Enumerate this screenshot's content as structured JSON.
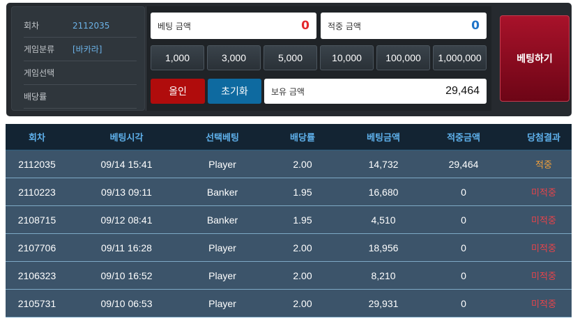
{
  "info": {
    "rows": [
      {
        "label": "회차",
        "value": "2112035"
      },
      {
        "label": "게임분류",
        "value": "[바카라]"
      },
      {
        "label": "게임선택",
        "value": ""
      },
      {
        "label": "배당률",
        "value": ""
      }
    ]
  },
  "bet_panel": {
    "bet_amount_label": "베팅 금액",
    "bet_amount_value": "0",
    "win_amount_label": "적중 금액",
    "win_amount_value": "0",
    "chips": [
      "1,000",
      "3,000",
      "5,000",
      "10,000",
      "100,000",
      "1,000,000"
    ],
    "allin_label": "올인",
    "reset_label": "초기화",
    "balance_label": "보유 금액",
    "balance_value": "29,464",
    "bet_button_label": "베팅하기"
  },
  "colors": {
    "bet_value": "#e3262b",
    "win_value": "#1e73c8",
    "allin_bg": "#b00c0c",
    "reset_bg": "#0e6aa0",
    "status_win": "#f2a03a",
    "status_miss": "#e8434a"
  },
  "table": {
    "headers": [
      "회차",
      "베팅시각",
      "선택베팅",
      "배당률",
      "베팅금액",
      "적중금액",
      "당첨결과"
    ],
    "rows": [
      {
        "round": "2112035",
        "time": "09/14 15:41",
        "pick": "Player",
        "odds": "2.00",
        "bet": "14,732",
        "win": "29,464",
        "result": "적중",
        "status": "win"
      },
      {
        "round": "2110223",
        "time": "09/13 09:11",
        "pick": "Banker",
        "odds": "1.95",
        "bet": "16,680",
        "win": "0",
        "result": "미적중",
        "status": "miss"
      },
      {
        "round": "2108715",
        "time": "09/12 08:41",
        "pick": "Banker",
        "odds": "1.95",
        "bet": "4,510",
        "win": "0",
        "result": "미적중",
        "status": "miss"
      },
      {
        "round": "2107706",
        "time": "09/11 16:28",
        "pick": "Player",
        "odds": "2.00",
        "bet": "18,956",
        "win": "0",
        "result": "미적중",
        "status": "miss"
      },
      {
        "round": "2106323",
        "time": "09/10 16:52",
        "pick": "Player",
        "odds": "2.00",
        "bet": "8,210",
        "win": "0",
        "result": "미적중",
        "status": "miss"
      },
      {
        "round": "2105731",
        "time": "09/10 06:53",
        "pick": "Player",
        "odds": "2.00",
        "bet": "29,931",
        "win": "0",
        "result": "미적중",
        "status": "miss"
      }
    ]
  }
}
